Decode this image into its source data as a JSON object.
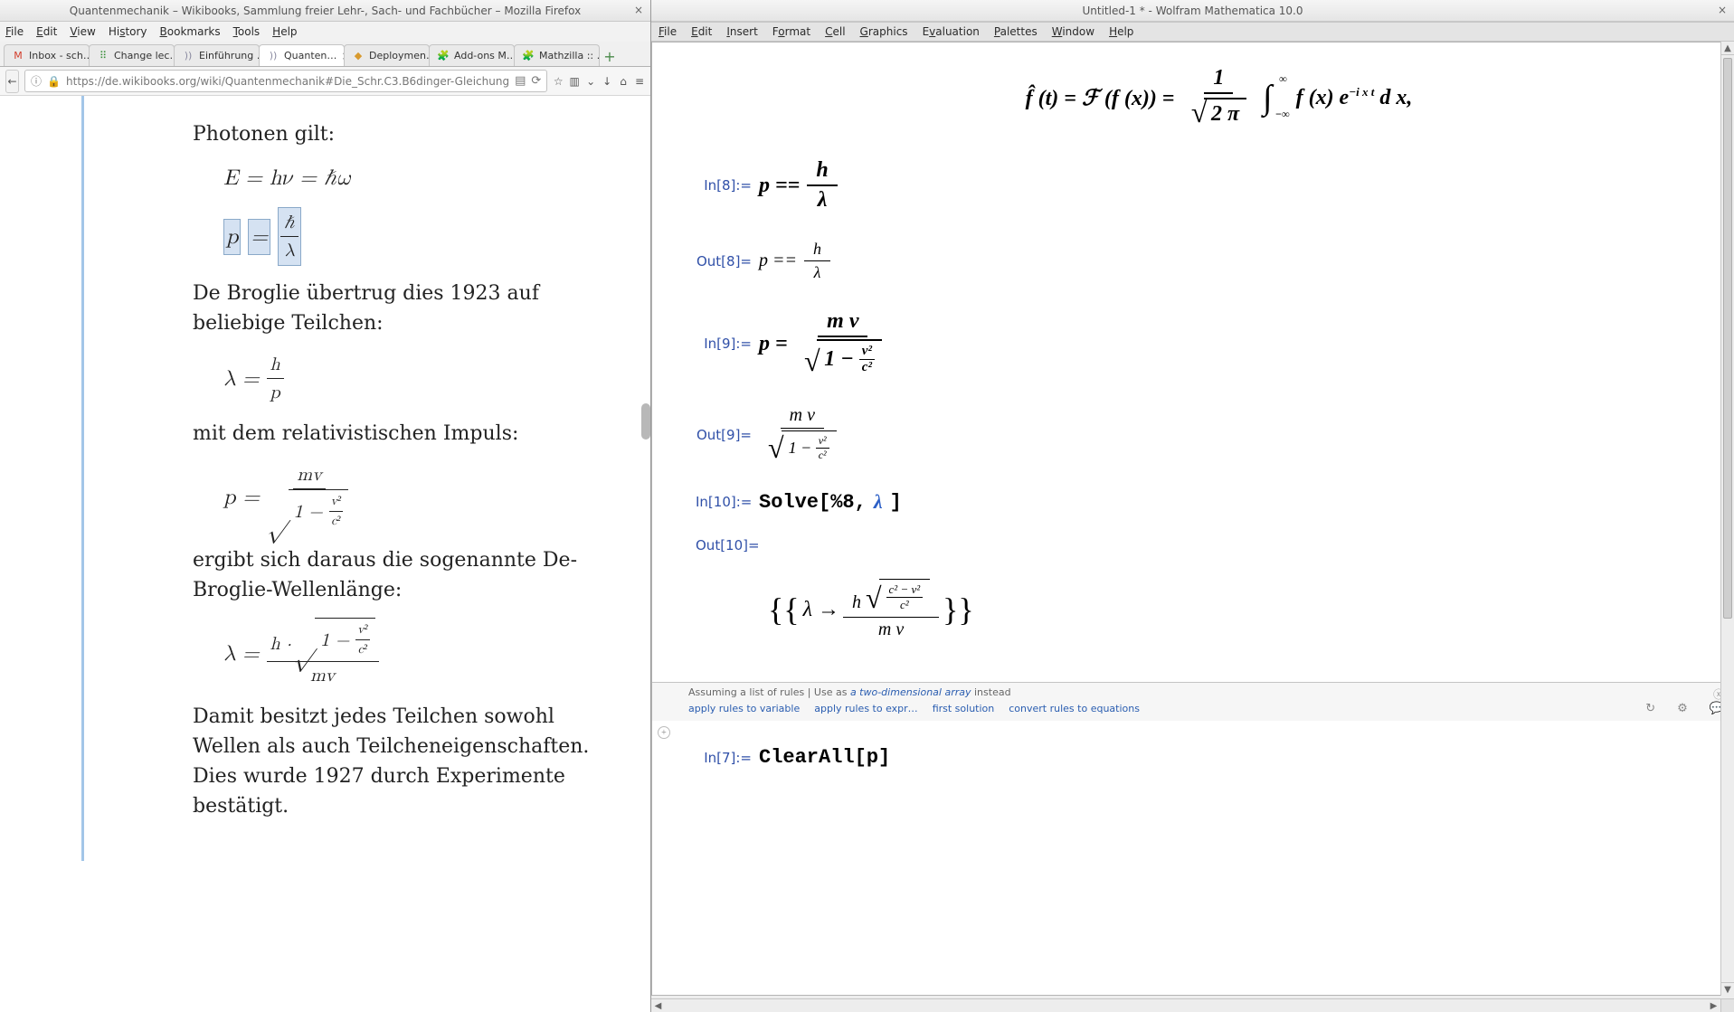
{
  "firefox": {
    "title": "Quantenmechanik – Wikibooks, Sammlung freier Lehr-, Sach- und Fachbücher – Mozilla Firefox",
    "menus": [
      "File",
      "Edit",
      "View",
      "History",
      "Bookmarks",
      "Tools",
      "Help"
    ],
    "tabs": [
      {
        "label": "Inbox - sch…",
        "icon": "M",
        "icon_color": "#d23c2a"
      },
      {
        "label": "Change lec…",
        "icon": "⠿",
        "icon_color": "#3a8f3a"
      },
      {
        "label": "Einführung …",
        "icon": "))",
        "icon_color": "#8a8aa0"
      },
      {
        "label": "Quanten…",
        "icon": "))",
        "icon_color": "#8a8aa0",
        "active": true,
        "closable": true
      },
      {
        "label": "Deploymen…",
        "icon": "◆",
        "icon_color": "#d89a2e"
      },
      {
        "label": "Add-ons M…",
        "icon": "🧩",
        "icon_color": "#3a8f3a"
      },
      {
        "label": "Mathzilla :: …",
        "icon": "🧩",
        "icon_color": "#3a8f3a"
      }
    ],
    "url": "https://de.wikibooks.org/wiki/Quantenmechanik#Die_Schr.C3.B6dinger-Gleichung",
    "article": {
      "p1": "Photonen gilt:",
      "eq1": "E = hν = ℏω",
      "eq2_lhs": "p",
      "eq2_eq": "=",
      "eq2_num": "ℏ",
      "eq2_den": "λ",
      "p2": "De Broglie übertrug dies 1923 auf beliebige Teilchen:",
      "eq3_lhs": "λ =",
      "eq3_num": "h",
      "eq3_den": "p",
      "p3": "mit dem relativistischen Impuls:",
      "eq4_lhs": "p =",
      "eq4_num": "mv",
      "eq4_inner": "1 −",
      "eq4_sf_num": "v²",
      "eq4_sf_den": "c²",
      "p4": "ergibt sich daraus die sogenannte De-Broglie-Wellenlänge:",
      "eq5_lhs": "λ =",
      "eq5_num_h": "h ·",
      "eq5_inner": "1 −",
      "eq5_sf_num": "v²",
      "eq5_sf_den": "c²",
      "eq5_den": "mv",
      "p5": "Damit besitzt jedes Teilchen sowohl Wellen als auch Teilcheneigenschaften. Dies wurde 1927 durch Experimente bestätigt."
    }
  },
  "mathematica": {
    "title": "Untitled-1 * - Wolfram Mathematica 10.0",
    "menus": [
      "File",
      "Edit",
      "Insert",
      "Format",
      "Cell",
      "Graphics",
      "Evaluation",
      "Palettes",
      "Window",
      "Help"
    ],
    "cells": {
      "ft_hat": "f̂ (t) = ℱ (f (x)) =",
      "ft_one": "1",
      "ft_2pi": "2 π",
      "ft_int_top": "∞",
      "ft_int_bot": "−∞",
      "ft_integ": "f (x) e",
      "ft_exp": "−i x t",
      "ft_dx": " d x,",
      "in8_label": "In[8]:=",
      "in8_lhs": "p ==",
      "in8_num": "h",
      "in8_den": "λ",
      "out8_label": "Out[8]=",
      "out8_lhs": "p ==",
      "out8_num": "h",
      "out8_den": "λ",
      "in9_label": "In[9]:=",
      "in9_lhs": "p =",
      "in9_num": "m v",
      "in9_inner": "1 −",
      "in9_sf_num": "v²",
      "in9_sf_den": "c²",
      "out9_label": "Out[9]=",
      "out9_num": "m v",
      "out9_inner": "1 −",
      "out9_sf_num": "v²",
      "out9_sf_den": "c²",
      "in10_label": "In[10]:=",
      "in10_expr_pre": "Solve[%8, ",
      "in10_expr_lam": "λ",
      "in10_expr_post": "]",
      "out10_label": "Out[10]=",
      "sol_lam": "λ →",
      "sol_h": "h",
      "sol_sf_num": "c² − v²",
      "sol_sf_den": "c²",
      "sol_den": "m v",
      "in7_label": "In[7]:=",
      "in7_expr": "ClearAll[p]"
    },
    "suggest": {
      "hint_pre": "Assuming a list of rules | Use as ",
      "hint_link": "a two-dimensional array",
      "hint_post": " instead",
      "links": [
        "apply rules to variable",
        "apply rules to expr…",
        "first solution",
        "convert rules to equations"
      ]
    }
  }
}
